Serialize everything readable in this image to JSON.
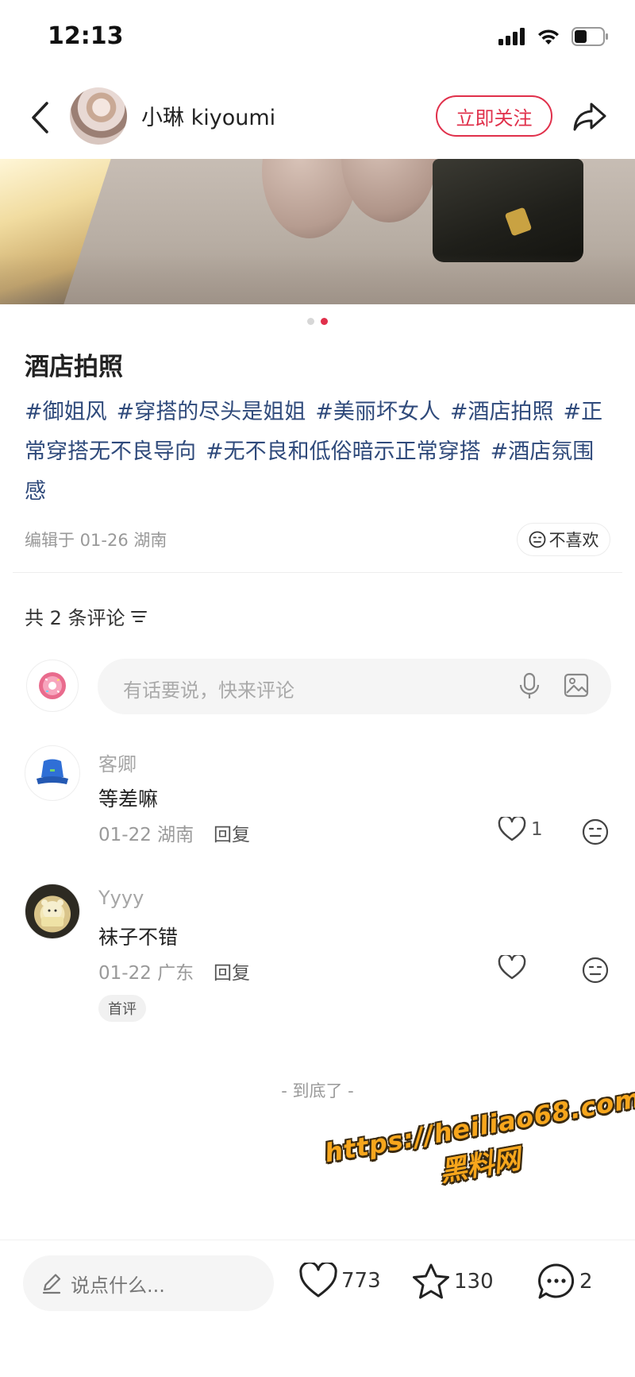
{
  "status_bar": {
    "time": "12:13"
  },
  "author": {
    "name": "小琳 kiyoumi",
    "follow_label": "立即关注"
  },
  "carousel": {
    "total": 2,
    "active": 2
  },
  "post": {
    "title": "酒店拍照",
    "tags": [
      "#御姐风",
      "#穿搭的尽头是姐姐",
      "#美丽坏女人",
      "#酒店拍照",
      "#正常穿搭无不良导向",
      "#无不良和低俗暗示正常穿搭",
      "#酒店氛围感"
    ],
    "meta": "编辑于 01-26 湖南",
    "dislike_label": "不喜欢"
  },
  "comments_section": {
    "header": "共 2 条评论",
    "input_placeholder": "有话要说，快来评论",
    "items": [
      {
        "user": "客卿",
        "text": "等差嘛",
        "meta": "01-22 湖南",
        "reply_label": "回复",
        "likes": "1",
        "badge": ""
      },
      {
        "user": "Yyyy",
        "text": "袜子不错",
        "meta": "01-22 广东",
        "reply_label": "回复",
        "likes": "",
        "badge": "首评"
      }
    ],
    "end_text": "- 到底了 -"
  },
  "watermark": {
    "line1": "https://heiliao68.com",
    "line2": "黑料网"
  },
  "bottom_bar": {
    "input_placeholder": "说点什么...",
    "likes": "773",
    "favorites": "130",
    "comments": "2"
  },
  "colors": {
    "accent": "#e0304b",
    "tag": "#2f4a7b"
  }
}
